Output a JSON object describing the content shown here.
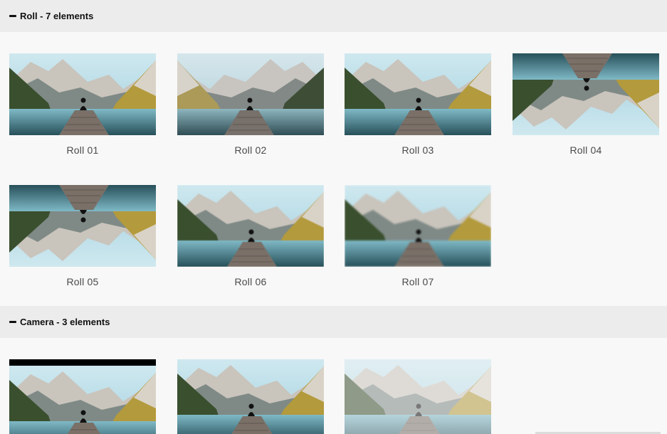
{
  "sections": [
    {
      "title": "Roll - 7 elements",
      "items": [
        {
          "label": "Roll 01",
          "thumbnail": "lake-dock-image"
        },
        {
          "label": "Roll 02",
          "thumbnail": "lake-dock-image"
        },
        {
          "label": "Roll 03",
          "thumbnail": "lake-dock-image"
        },
        {
          "label": "Roll 04",
          "thumbnail": "lake-dock-image"
        },
        {
          "label": "Roll 05",
          "thumbnail": "lake-dock-image"
        },
        {
          "label": "Roll 06",
          "thumbnail": "lake-dock-image"
        },
        {
          "label": "Roll 07",
          "thumbnail": "lake-dock-image"
        }
      ]
    },
    {
      "title": "Camera - 3 elements",
      "items": [
        {
          "thumbnail": "lake-dock-image"
        },
        {
          "thumbnail": "lake-dock-image"
        },
        {
          "thumbnail": "lake-dock-image"
        }
      ]
    }
  ],
  "icons": {
    "section_toggle": "minus-collapse-icon"
  },
  "colors": {
    "header_bg": "#ececec",
    "page_bg": "#f8f8f8",
    "sky": "#aed6e4",
    "water": "#2f5e66",
    "mountain": "#c9c4bc",
    "forest": "#3a4f2e",
    "autumn": "#b39a3c",
    "dock": "#7a7068",
    "figure": "#111111"
  }
}
